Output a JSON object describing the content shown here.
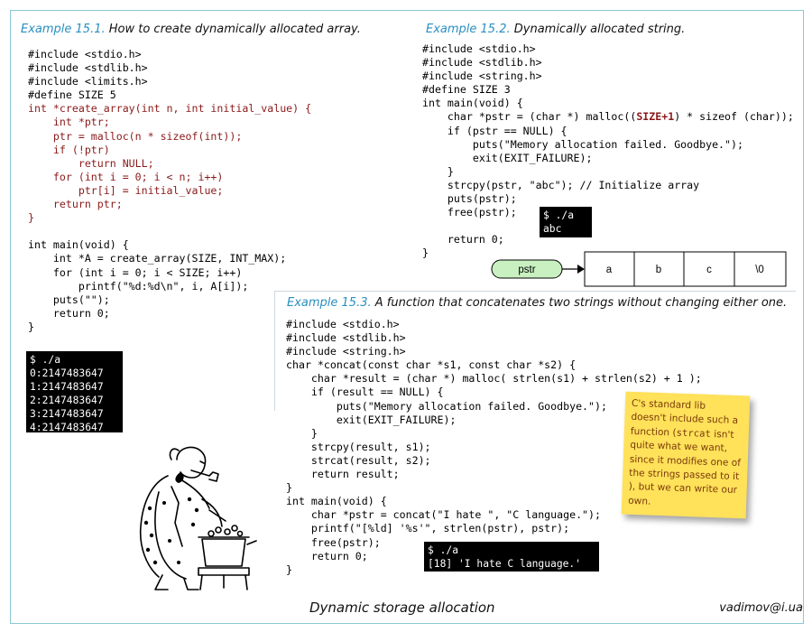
{
  "ex1": {
    "number": "Example 15.1.",
    "title": "How to create dynamically allocated array.",
    "code": [
      "#include <stdio.h>",
      "#include <stdlib.h>",
      "#include <limits.h>",
      "#define SIZE 5",
      "int *create_array(int n, int initial_value) {",
      "    int *ptr;",
      "    ptr = malloc(n * sizeof(int));",
      "    if (!ptr)",
      "        return NULL;",
      "    for (int i = 0; i < n; i++)",
      "        ptr[i] = initial_value;",
      "    return ptr;",
      "}",
      "",
      "int main(void) {",
      "    int *A = create_array(SIZE, INT_MAX);",
      "    for (int i = 0; i < SIZE; i++)",
      "        printf(\"%d:%d\\n\", i, A[i]);",
      "    puts(\"\");",
      "    return 0;",
      "}"
    ],
    "terminal": "$ ./a\n0:2147483647\n1:2147483647\n2:2147483647\n3:2147483647\n4:2147483647"
  },
  "ex2": {
    "number": "Example 15.2.",
    "title": "Dynamically allocated string.",
    "code_before": "#include <stdio.h>\n#include <stdlib.h>\n#include <string.h>\n#define SIZE 3\nint main(void) {\n    char *pstr = (char *) malloc((",
    "code_bold": "SIZE+1",
    "code_after": ") * sizeof (char));\n    if (pstr == NULL) {\n        puts(\"Memory allocation failed. Goodbye.\");\n        exit(EXIT_FAILURE);\n    }\n    strcpy(pstr, \"abc\"); // Initialize array\n    puts(pstr);\n    free(pstr);\n\n    return 0;\n}",
    "terminal": "$ ./a\nabc",
    "diagram": {
      "pointer_label": "pstr",
      "cells": [
        "a",
        "b",
        "c",
        "\\0"
      ]
    }
  },
  "ex3": {
    "number": "Example 15.3.",
    "title": " A function that concatenates two strings without changing either one.",
    "code": "#include <stdio.h>\n#include <stdlib.h>\n#include <string.h>\nchar *concat(const char *s1, const char *s2) {\n    char *result = (char *) malloc( strlen(s1) + strlen(s2) + 1 );\n    if (result == NULL) {\n        puts(\"Memory allocation failed. Goodbye.\");\n        exit(EXIT_FAILURE);\n    }\n    strcpy(result, s1);\n    strcat(result, s2);\n    return result;\n}\nint main(void) {\n    char *pstr = concat(\"I hate \", \"C language.\");\n    printf(\"[%ld] '%s'\", strlen(pstr), pstr);\n    free(pstr);\n    return 0;\n}",
    "terminal": "$ ./a\n[18] 'I hate C language.'"
  },
  "note": {
    "text_before": "C's standard lib doesn't include such a function (",
    "code": "strcat",
    "text_after": " isn't quite what we want, since it modifies one of the strings passed to it ), but we can write our own."
  },
  "footer": {
    "title": "Dynamic storage allocation",
    "email": "vadimov@i.ua"
  },
  "colors": {
    "accent": "#2a8fc0",
    "code_keyword_red": "#8a1a1a",
    "note_bg": "#ffe15a",
    "pointer_fill": "#c8f0c0"
  }
}
